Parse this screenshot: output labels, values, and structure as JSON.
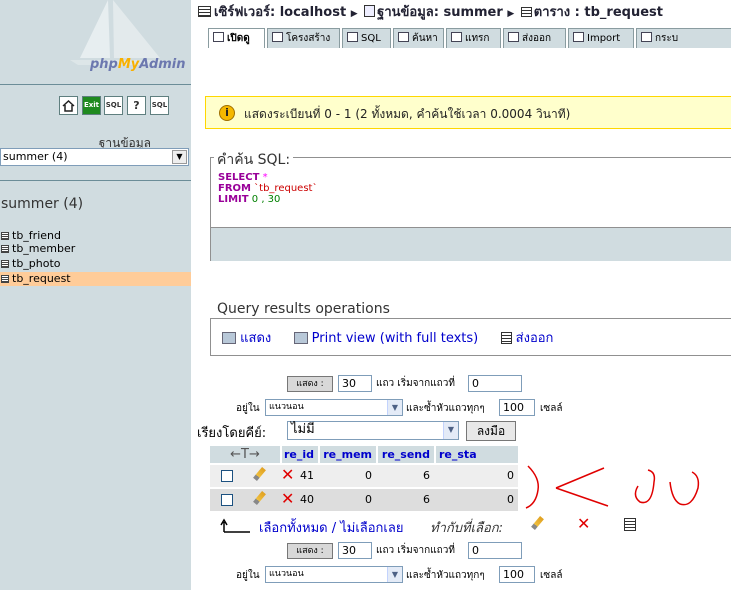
{
  "sidebar": {
    "logo_pre": "php",
    "logo_mid": "My",
    "logo_post": "Admin",
    "icons": [
      "home-icon",
      "exit-icon",
      "sql-icon",
      "docs-icon",
      "query-icon"
    ],
    "icon_labels": [
      "⌂",
      "Exit",
      "SQL",
      "?",
      "SQL"
    ],
    "db_label": "ฐานข้อมูล",
    "db_select": "summer (4)",
    "db_title": "summer (4)",
    "tables": [
      "tb_friend",
      "tb_member",
      "tb_photo",
      "tb_request"
    ]
  },
  "breadcrumb": {
    "server": "เซิร์ฟเวอร์: localhost",
    "database": "ฐานข้อมูล: summer",
    "table": "ตาราง : tb_request"
  },
  "tabs": [
    "เปิดดู",
    "โครงสร้าง",
    "SQL",
    "ค้นหา",
    "แทรก",
    "ส่งออก",
    "Import",
    "กระบ"
  ],
  "notice": {
    "text": "แสดงระเบียนที่ 0 - 1 (2 ทั้งหมด, คำค้นใช้เวลา 0.0004 วินาที)"
  },
  "sql": {
    "legend": "คำค้น SQL:",
    "select_kw": "SELECT",
    "star": " *",
    "from_kw": "FROM",
    "table": " `tb_request`",
    "limit_kw": "LIMIT",
    "limit_vals": " 0 , 30"
  },
  "query_ops": {
    "legend": "Query results operations",
    "show": "แสดง",
    "print": "Print view (with full texts)",
    "export": "ส่งออก"
  },
  "nav": {
    "show_button": "แสดง :",
    "rows": "30",
    "rows_label": "แถว เริ่มจากแถวที่",
    "start": "0",
    "in_label": "อยู่ใน",
    "mode": "แนวนอน",
    "repeat_label": "และซ้ำหัวแถวทุกๆ",
    "repeat": "100",
    "cells_label": "เซลล์"
  },
  "sort": {
    "label": "เรียงโดยคีย์:",
    "value": "ไม่มี",
    "go": "ลงมือ"
  },
  "table": {
    "arrows": "←T→",
    "columns": [
      "re_id",
      "re_mem",
      "re_send",
      "re_sta"
    ],
    "rows": [
      [
        "41",
        "0",
        "6",
        "0"
      ],
      [
        "40",
        "0",
        "6",
        "0"
      ]
    ]
  },
  "select_all": {
    "text": "เลือกทั้งหมด / ไม่เลือกเลย",
    "with_selected": "ทำกับที่เลือก:"
  },
  "colors": {
    "sidebar": "#d0dce0",
    "highlight": "#ffcc99",
    "notice_bg": "#ffffcc",
    "notice_border": "#ffd700",
    "link": "#0000cc",
    "annotation": "#e00000"
  }
}
